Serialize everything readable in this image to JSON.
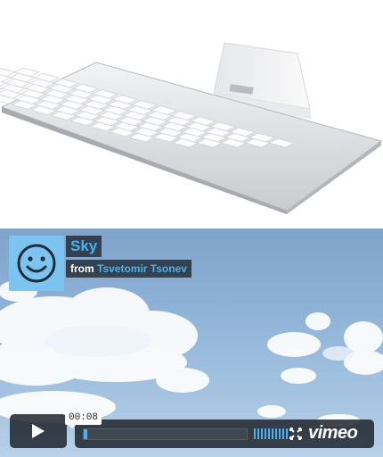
{
  "video": {
    "title": "Sky",
    "byline_prefix": "from",
    "author": "Tsvetomir Tsonev",
    "timecode": "00:08",
    "progress_fraction": 0.02,
    "volume_bars": 10,
    "logo_text": "vimeo"
  },
  "colors": {
    "accent": "#4ab0ee",
    "avatar_bg": "#7cc3ef",
    "control_bg": "#1e242c"
  },
  "icons": [
    "smiley-face-icon",
    "play-icon",
    "fullscreen-icon"
  ]
}
